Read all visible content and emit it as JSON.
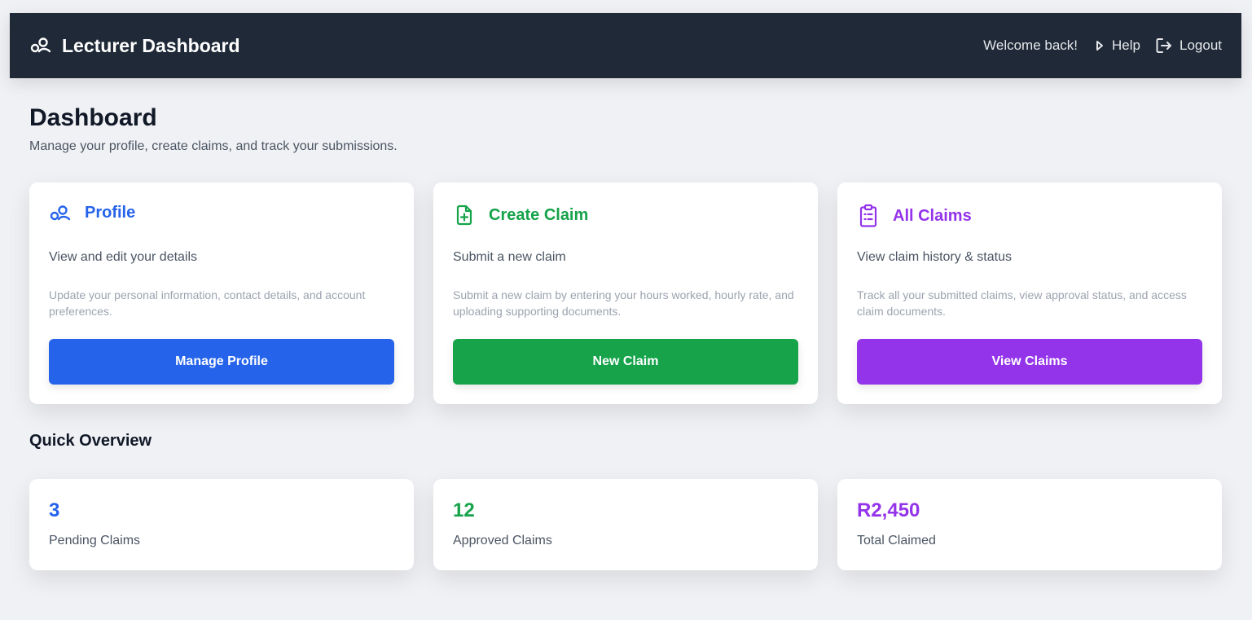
{
  "header": {
    "title": "Lecturer Dashboard",
    "welcome": "Welcome back!",
    "help_label": "Help",
    "logout_label": "Logout"
  },
  "page": {
    "title": "Dashboard",
    "subtitle": "Manage your profile, create claims, and track your submissions."
  },
  "cards": [
    {
      "title": "Profile",
      "subtitle": "View and edit your details",
      "description": "Update your personal information, contact details, and account preferences.",
      "button": "Manage Profile",
      "color": "#2563eb",
      "icon": "users-icon"
    },
    {
      "title": "Create Claim",
      "subtitle": "Submit a new claim",
      "description": "Submit a new claim by entering your hours worked, hourly rate, and uploading supporting documents.",
      "button": "New Claim",
      "color": "#16a34a",
      "icon": "file-plus-icon"
    },
    {
      "title": "All Claims",
      "subtitle": "View claim history & status",
      "description": "Track all your submitted claims, view approval status, and access claim documents.",
      "button": "View Claims",
      "color": "#9333ea",
      "icon": "clipboard-list-icon"
    }
  ],
  "overview": {
    "title": "Quick Overview",
    "stats": [
      {
        "value": "3",
        "label": "Pending Claims",
        "color": "#2563eb"
      },
      {
        "value": "12",
        "label": "Approved Claims",
        "color": "#16a34a"
      },
      {
        "value": "R2,450",
        "label": "Total Claimed",
        "color": "#9333ea"
      }
    ]
  }
}
